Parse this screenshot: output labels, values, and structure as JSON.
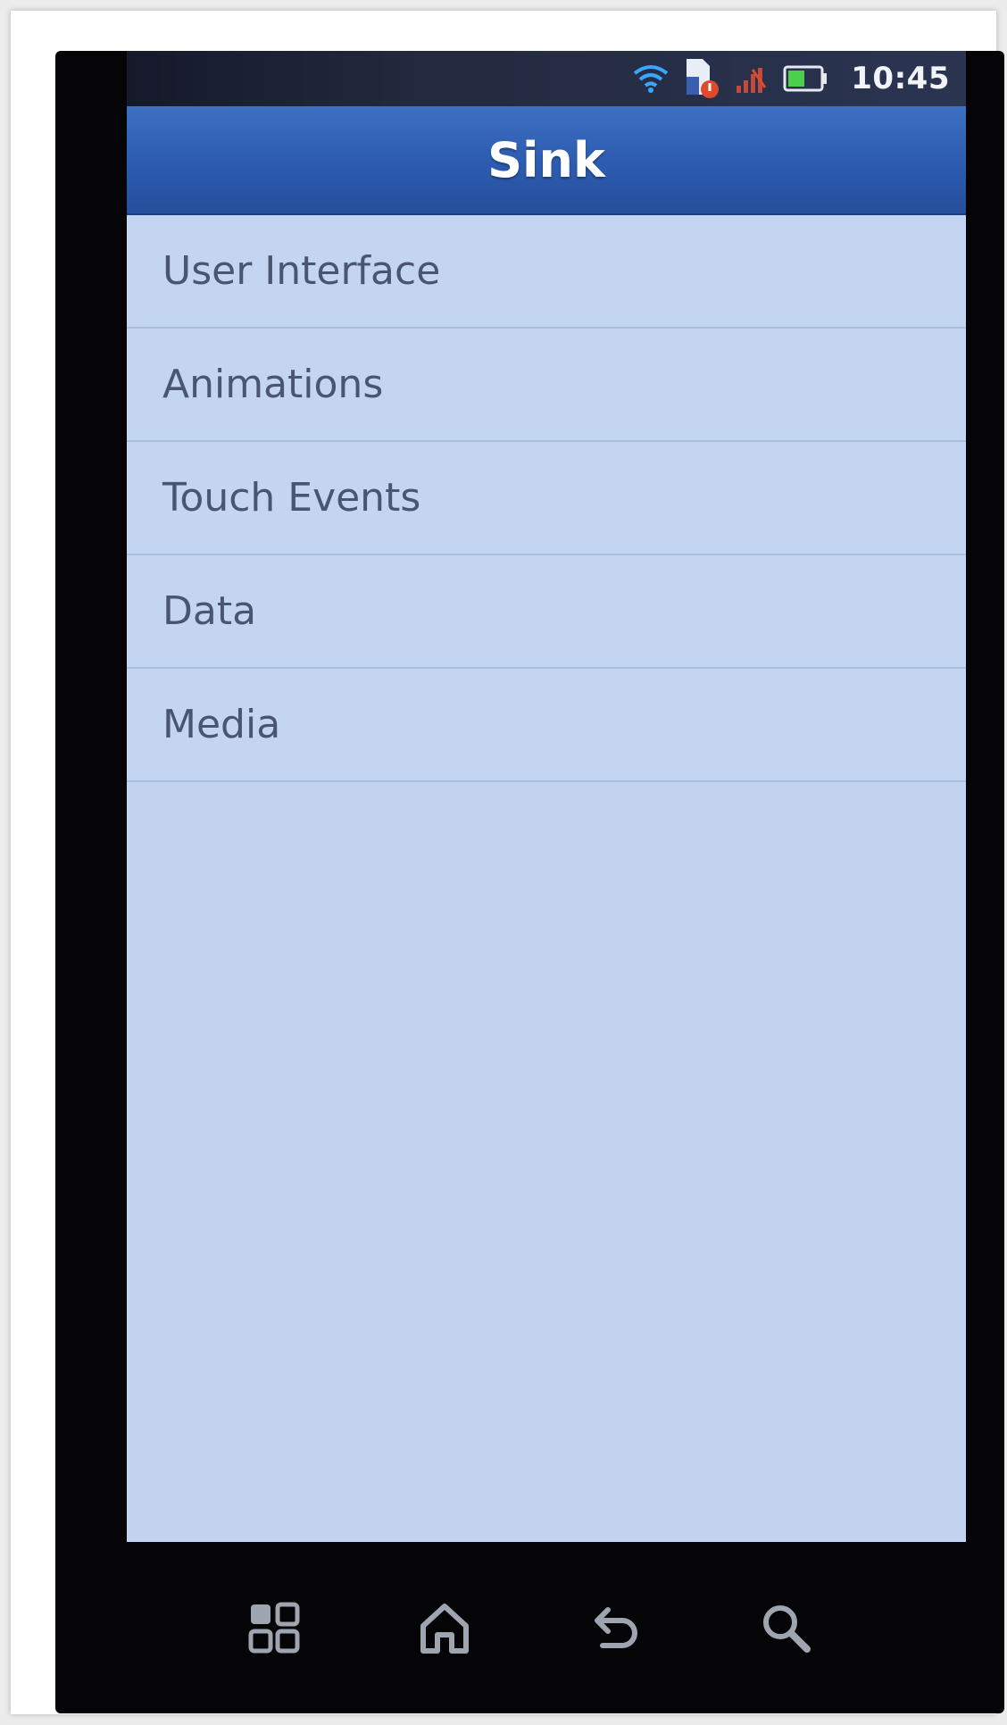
{
  "status_bar": {
    "time": "10:45",
    "icons": [
      "wifi-icon",
      "notification-icon",
      "signal-icon",
      "battery-icon"
    ]
  },
  "app": {
    "title": "Sink"
  },
  "menu": {
    "items": [
      {
        "label": "User Interface"
      },
      {
        "label": "Animations"
      },
      {
        "label": "Touch Events"
      },
      {
        "label": "Data"
      },
      {
        "label": "Media"
      }
    ]
  },
  "nav_bar": {
    "buttons": [
      "menu-icon",
      "home-icon",
      "back-icon",
      "search-icon"
    ]
  },
  "colors": {
    "title_bar": "#2c5bb0",
    "list_background": "#c4d5f1",
    "item_text": "#4a5670",
    "device": "#050507"
  }
}
